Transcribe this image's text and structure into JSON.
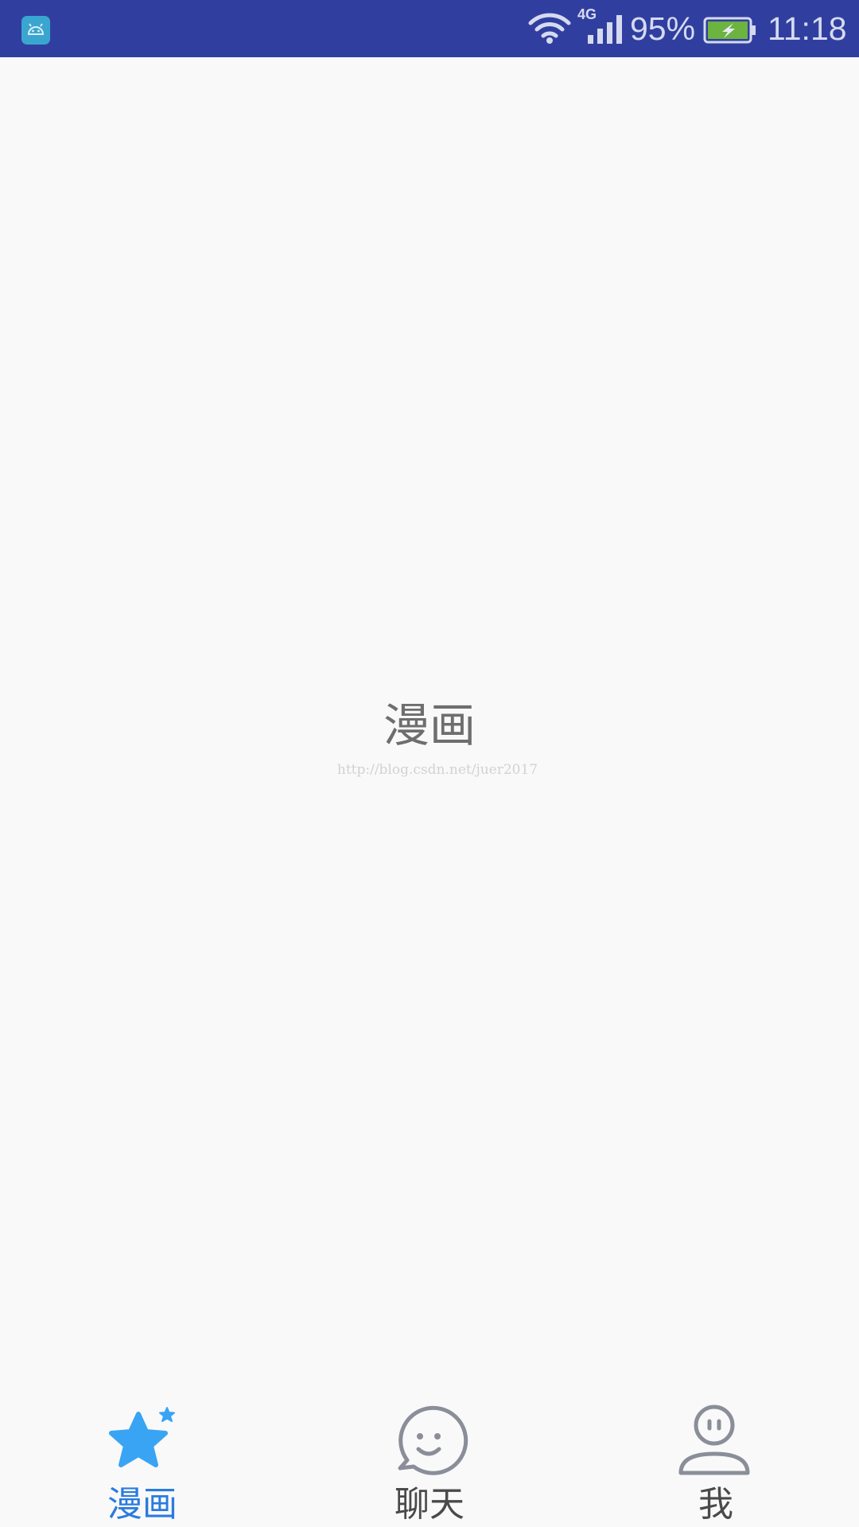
{
  "status_bar": {
    "network_type": "4G",
    "battery_percent": "95%",
    "time": "11:18",
    "background_color": "#303F9F",
    "icons": [
      "android-app-icon",
      "wifi-icon",
      "signal-icon",
      "battery-charging-icon"
    ]
  },
  "content": {
    "title": "漫画",
    "watermark": "http://blog.csdn.net/juer2017"
  },
  "bottom_nav": {
    "active_color": "#2A7BDE",
    "inactive_color": "#4A4A4A",
    "tabs": [
      {
        "label": "漫画",
        "icon": "star-icon",
        "active": true
      },
      {
        "label": "聊天",
        "icon": "smiley-chat-icon",
        "active": false
      },
      {
        "label": "我",
        "icon": "person-icon",
        "active": false
      }
    ]
  }
}
